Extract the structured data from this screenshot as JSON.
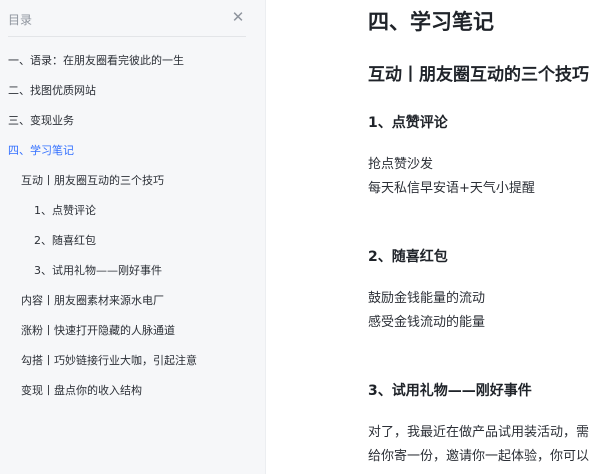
{
  "toc": {
    "title": "目录",
    "close_icon": "close-icon",
    "items": [
      {
        "label": "一、语录：在朋友圈看完彼此的一生",
        "level": 1
      },
      {
        "label": "二、找图优质网站",
        "level": 1
      },
      {
        "label": "三、变现业务",
        "level": 1
      },
      {
        "label": "四、学习笔记",
        "level": 1,
        "active": true
      },
      {
        "label": "互动丨朋友圈互动的三个技巧",
        "level": 2
      },
      {
        "label": "1、点赞评论",
        "level": 3
      },
      {
        "label": "2、随喜红包",
        "level": 3
      },
      {
        "label": "3、试用礼物——刚好事件",
        "level": 3
      },
      {
        "label": "内容丨朋友圈素材来源水电厂",
        "level": 2
      },
      {
        "label": "涨粉丨快速打开隐藏的人脉通道",
        "level": 2
      },
      {
        "label": "勾搭丨巧妙链接行业大咖，引起注意",
        "level": 2
      },
      {
        "label": "变现丨盘点你的收入结构",
        "level": 2
      }
    ]
  },
  "doc": {
    "h1": "四、学习笔记",
    "h2": "互动丨朋友圈互动的三个技巧",
    "s1": {
      "heading": "1、点赞评论",
      "lines": [
        "抢点赞沙发",
        "每天私信早安语+天气小提醒"
      ]
    },
    "s2": {
      "heading": "2、随喜红包",
      "lines": [
        "鼓励金钱能量的流动",
        "感受金钱流动的能量"
      ]
    },
    "s3": {
      "heading": "3、试用礼物——刚好事件",
      "lines": [
        "对了，我最近在做产品试用装活动，需",
        "给你寄一份，邀请你一起体验，你可以"
      ]
    }
  },
  "colors": {
    "accent": "#3370ff",
    "sidebar_bg": "#f6f7f9",
    "text": "#1f2329",
    "muted": "#8f959e"
  }
}
